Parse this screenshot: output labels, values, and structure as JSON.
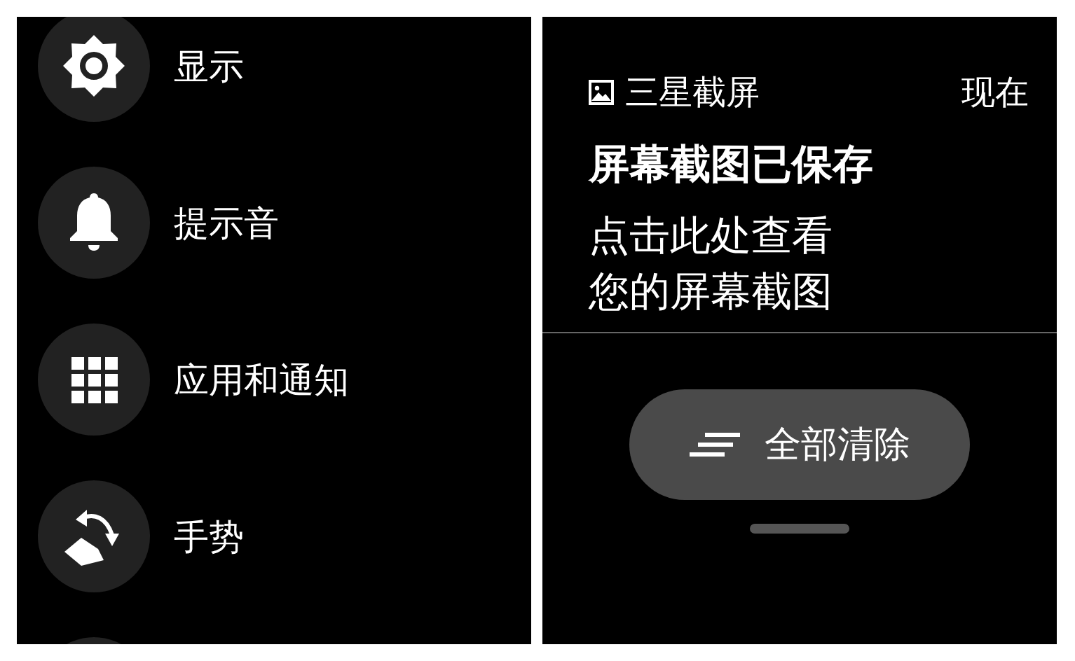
{
  "settings_screen": {
    "items": [
      {
        "kind": "display",
        "label": "显示"
      },
      {
        "kind": "sound",
        "label": "提示音"
      },
      {
        "kind": "apps",
        "label": "应用和通知"
      },
      {
        "kind": "gesture",
        "label": "手势"
      }
    ]
  },
  "notification_screen": {
    "app_name": "三星截屏",
    "time": "现在",
    "title": "屏幕截图已保存",
    "body_lines": [
      "点击此处查看",
      "您的屏幕截图"
    ],
    "clear_button": "全部清除"
  }
}
